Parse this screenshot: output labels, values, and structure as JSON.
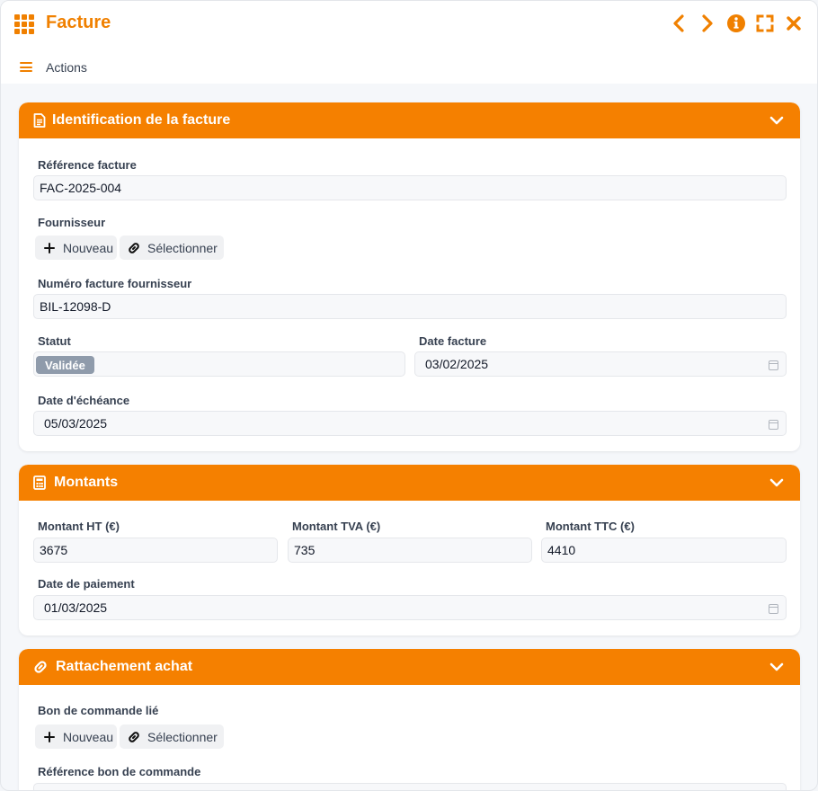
{
  "window": {
    "title": "Facture",
    "accent_color": "#f58000",
    "controls": [
      {
        "name": "previous-icon"
      },
      {
        "name": "next-icon"
      },
      {
        "name": "info-icon"
      },
      {
        "name": "fullscreen-icon"
      },
      {
        "name": "close-icon"
      }
    ]
  },
  "actions_bar": {
    "label": "Actions"
  },
  "sections": {
    "identification": {
      "title": "Identification de la facture",
      "icon": "document-icon",
      "reference_label": "Référence facture",
      "reference_value": "FAC-2025-004",
      "supplier_label": "Fournisseur",
      "new_label": "Nouveau",
      "select_label": "Sélectionner",
      "supplier_invoice_label": "Numéro facture fournisseur",
      "supplier_invoice_value": "BIL-12098-D",
      "status_label": "Statut",
      "status_value": "Validée",
      "status_color": "#8f9bab",
      "invoice_date_label": "Date facture",
      "invoice_date_value": "03/02/2025",
      "due_date_label": "Date d'échéance",
      "due_date_value": "05/03/2025"
    },
    "amounts": {
      "title": "Montants",
      "icon": "calculator-icon",
      "ht_label": "Montant HT (€)",
      "ht_value": "3675",
      "tva_label": "Montant TVA (€)",
      "tva_value": "735",
      "ttc_label": "Montant TTC (€)",
      "ttc_value": "4410",
      "payment_date_label": "Date de paiement",
      "payment_date_value": "01/03/2025"
    },
    "purchase_link": {
      "title": "Rattachement achat",
      "icon": "link-icon",
      "order_label": "Bon de commande lié",
      "new_label": "Nouveau",
      "select_label": "Sélectionner",
      "order_ref_label": "Référence bon de commande"
    }
  }
}
